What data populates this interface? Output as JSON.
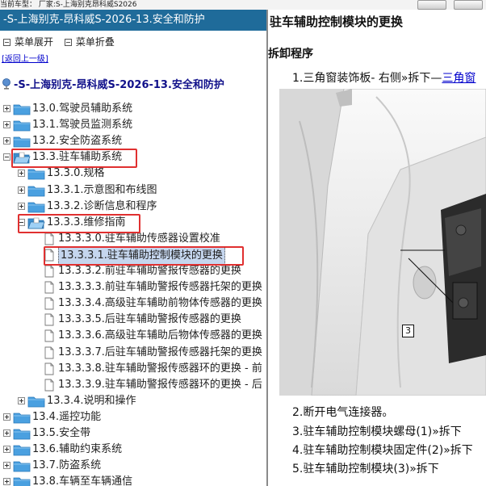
{
  "top": {
    "label": "当前车型： 厂家:S-上海别克昂科威S2026"
  },
  "sidebar": {
    "title": "-S-上海别克-昂科威S-2026-13.安全和防护",
    "expand_label": "菜单展开",
    "collapse_label": "菜单折叠",
    "back_label": "[返回上一级]",
    "root_label": "-S-上海别克-昂科威S-2026-13.安全和防护",
    "items": [
      {
        "label": "13.0.驾驶员辅助系统"
      },
      {
        "label": "13.1.驾驶员监测系统"
      },
      {
        "label": "13.2.安全防盗系统"
      },
      {
        "label": "13.3.驻车辅助系统"
      },
      {
        "label": "13.3.0.规格"
      },
      {
        "label": "13.3.1.示意图和布线图"
      },
      {
        "label": "13.3.2.诊断信息和程序"
      },
      {
        "label": "13.3.3.维修指南"
      },
      {
        "label": "13.3.3.0.驻车辅助传感器设置校准"
      },
      {
        "label": "13.3.3.1.驻车辅助控制模块的更换"
      },
      {
        "label": "13.3.3.2.前驻车辅助警报传感器的更换"
      },
      {
        "label": "13.3.3.3.前驻车辅助警报传感器托架的更换"
      },
      {
        "label": "13.3.3.4.高级驻车辅助前物体传感器的更换"
      },
      {
        "label": "13.3.3.5.后驻车辅助警报传感器的更换"
      },
      {
        "label": "13.3.3.6.高级驻车辅助后物体传感器的更换"
      },
      {
        "label": "13.3.3.7.后驻车辅助警报传感器托架的更换"
      },
      {
        "label": "13.3.3.8.驻车辅助警报传感器环的更换 - 前"
      },
      {
        "label": "13.3.3.9.驻车辅助警报传感器环的更换 - 后"
      },
      {
        "label": "13.3.4.说明和操作"
      },
      {
        "label": "13.4.遥控功能"
      },
      {
        "label": "13.5.安全带"
      },
      {
        "label": "13.6.辅助约束系统"
      },
      {
        "label": "13.7.防盗系统"
      },
      {
        "label": "13.8.车辆至车辆通信"
      }
    ]
  },
  "content": {
    "title": "驻车辅助控制模块的更换",
    "section": "拆卸程序",
    "step1_text": "1.三角窗装饰板- 右侧»拆下—",
    "step1_link": "三角窗",
    "callout": "3",
    "step2": "2.断开电气连接器。",
    "step3": "3.驻车辅助控制模块螺母(1)»拆下",
    "step4": "4.驻车辅助控制模块固定件(2)»拆下",
    "step5": "5.驻车辅助控制模块(3)»拆下"
  },
  "colors": {
    "titlebar": "#1f6b9a",
    "highlight": "#e03030",
    "folder": "#4aa0e0",
    "link": "#0000cc"
  }
}
